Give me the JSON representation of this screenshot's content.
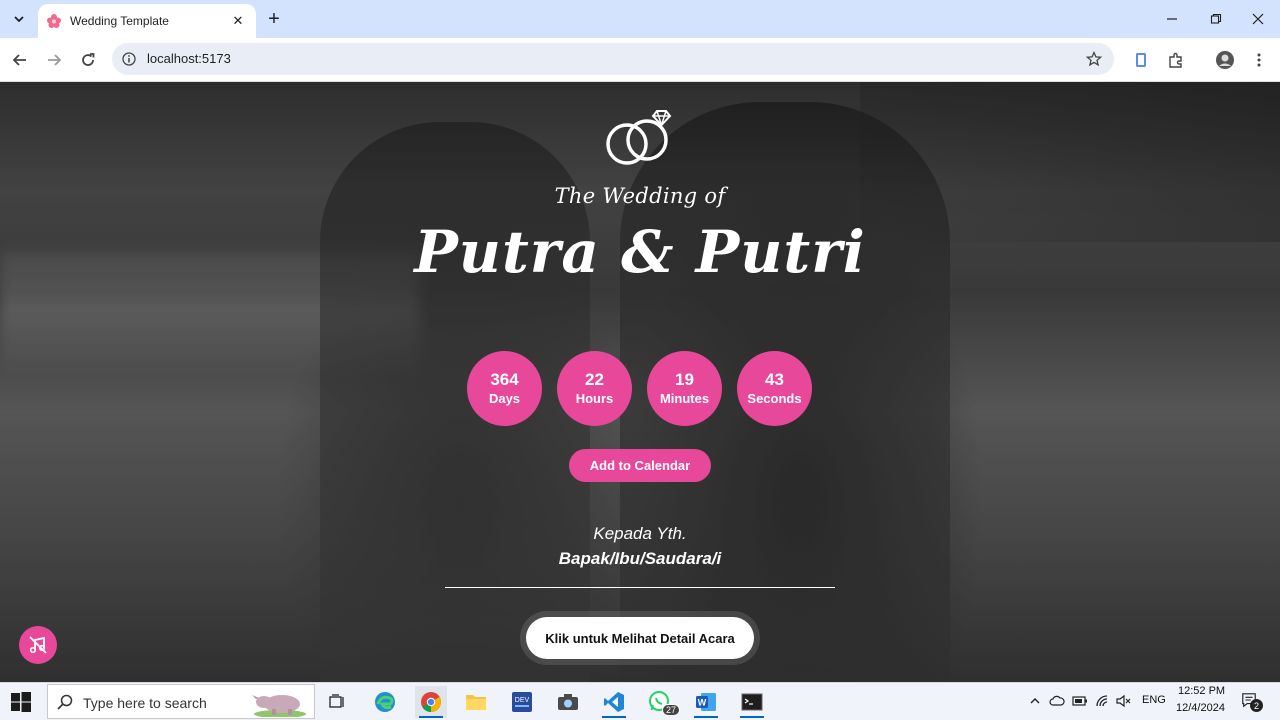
{
  "browser": {
    "tab_title": "Wedding Template",
    "url": "localhost:5173"
  },
  "hero": {
    "subtitle": "The Wedding of",
    "names": "Putra & Putri",
    "countdown": [
      {
        "value": "364",
        "label": "Days"
      },
      {
        "value": "22",
        "label": "Hours"
      },
      {
        "value": "19",
        "label": "Minutes"
      },
      {
        "value": "43",
        "label": "Seconds"
      }
    ],
    "calendar_button": "Add to Calendar",
    "salutation": "Kepada Yth.",
    "guest_name": "Bapak/Ibu/Saudara/i",
    "detail_button": "Klik untuk Melihat Detail Acara"
  },
  "colors": {
    "accent": "#e8489a",
    "tab_strip": "#d3e3fd"
  },
  "icons": {
    "music": "music-off-icon",
    "rings": "wedding-rings-icon"
  },
  "taskbar": {
    "search_placeholder": "Type here to search",
    "whatsapp_badge": "27",
    "language": "ENG",
    "time": "12:52 PM",
    "date": "12/4/2024",
    "notification_count": "2"
  }
}
